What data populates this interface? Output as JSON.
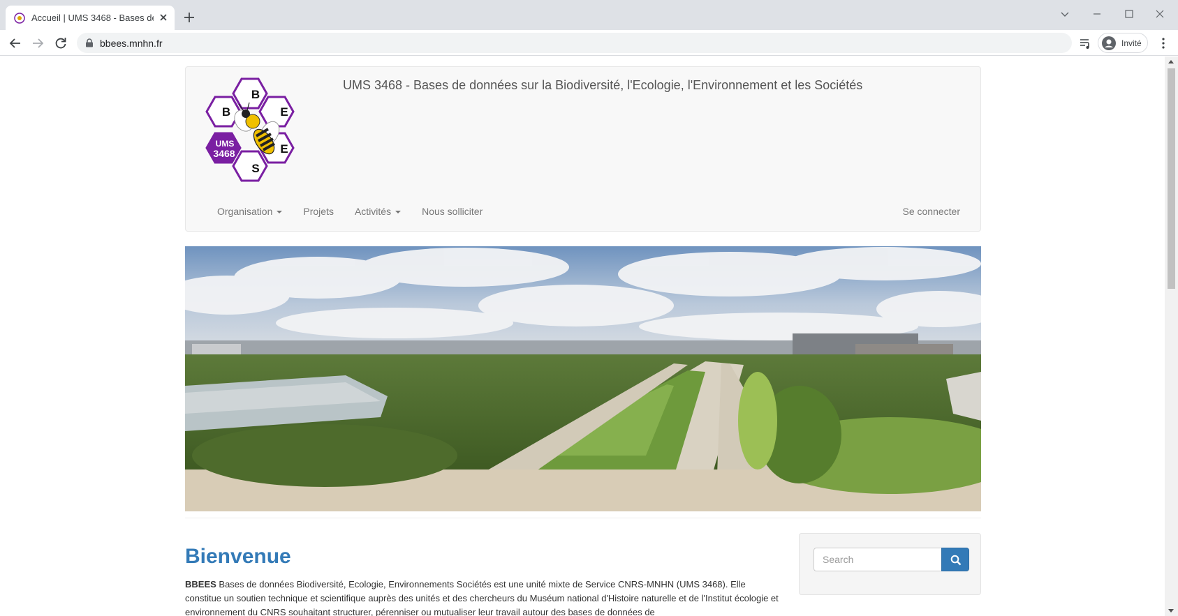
{
  "browser": {
    "tab_title": "Accueil | UMS 3468 - Bases de do",
    "url": "bbees.mnhn.fr",
    "profile_label": "Invité"
  },
  "header": {
    "site_title": "UMS 3468 - Bases de données sur la Biodiversité, l'Ecologie, l'Environnement et les Sociétés",
    "logo_letters": [
      "B",
      "B",
      "E",
      "E",
      "S"
    ],
    "logo_badge": [
      "UMS",
      "3468"
    ]
  },
  "nav": {
    "items": [
      {
        "label": "Organisation",
        "dropdown": true
      },
      {
        "label": "Projets",
        "dropdown": false
      },
      {
        "label": "Activités",
        "dropdown": true
      },
      {
        "label": "Nous solliciter",
        "dropdown": false
      }
    ],
    "login_label": "Se connecter"
  },
  "content": {
    "heading": "Bienvenue",
    "intro_strong": "BBEES",
    "intro_text": " Bases de données Biodiversité, Ecologie, Environnements Sociétés est une unité mixte de Service CNRS-MNHN (UMS 3468). Elle constitue un soutien technique et scientifique auprès des unités et des chercheurs du Muséum national d'Histoire naturelle et de l'Institut écologie et environnement du CNRS souhaitant structurer, pérenniser ou mutualiser leur travail autour des bases de données de"
  },
  "search": {
    "placeholder": "Search"
  },
  "colors": {
    "link_blue": "#337ab7",
    "logo_purple": "#7a1fa2",
    "navbar_bg": "#f8f8f8",
    "tabstrip_bg": "#dee1e6"
  }
}
